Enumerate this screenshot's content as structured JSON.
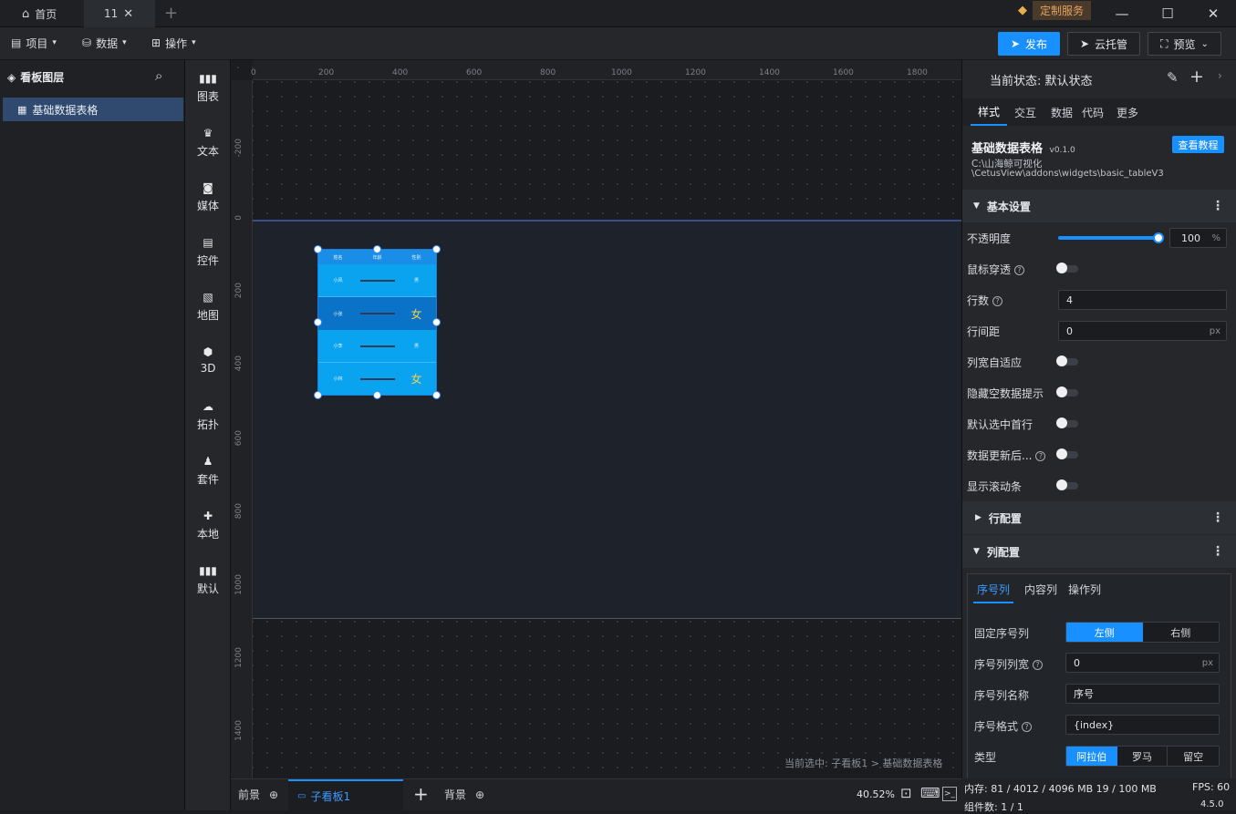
{
  "titlebar": {
    "tabs": [
      {
        "label": "首页",
        "icon": "home-icon"
      },
      {
        "label": "11",
        "icon": "close-icon"
      }
    ],
    "new_tab": "+",
    "custom_service": "定制服务"
  },
  "toolbar": {
    "menus": [
      {
        "label": "项目",
        "icon": "document-icon"
      },
      {
        "label": "数据",
        "icon": "database-icon"
      },
      {
        "label": "操作",
        "icon": "grid-icon"
      }
    ],
    "publish": "发布",
    "cloud": "云托管",
    "preview": "预览"
  },
  "layers": {
    "title": "看板图层",
    "items": [
      "基础数据表格"
    ]
  },
  "components": [
    {
      "label": "图表",
      "icon": "bar-chart-icon"
    },
    {
      "label": "文本",
      "icon": "crown-icon"
    },
    {
      "label": "媒体",
      "icon": "media-icon"
    },
    {
      "label": "控件",
      "icon": "form-icon"
    },
    {
      "label": "地图",
      "icon": "map-icon"
    },
    {
      "label": "3D",
      "icon": "cube-icon"
    },
    {
      "label": "拓扑",
      "icon": "topology-icon"
    },
    {
      "label": "套件",
      "icon": "shirt-icon"
    },
    {
      "label": "本地",
      "icon": "puzzle-icon"
    },
    {
      "label": "默认",
      "icon": "default-chart-icon"
    }
  ],
  "ruler": {
    "top": [
      "0",
      "200",
      "400",
      "600",
      "800",
      "1000",
      "1200",
      "1400",
      "1600",
      "1800"
    ],
    "left": [
      "-200",
      "0",
      "200",
      "400",
      "600",
      "800",
      "1000",
      "1200",
      "1400"
    ]
  },
  "widget": {
    "headers": [
      "姓名",
      "年龄",
      "性别"
    ],
    "rows": [
      {
        "name": "小风",
        "gender": "男"
      },
      {
        "name": "小张",
        "gender": "女"
      },
      {
        "name": "小李",
        "gender": "男"
      },
      {
        "name": "小林",
        "gender": "女"
      }
    ]
  },
  "canvas": {
    "breadcrumb": "当前选中: 子看板1 > 基础数据表格",
    "bottom_tabs": {
      "foreground": "前景",
      "sub_board": "子看板1",
      "add": "+",
      "background": "背景"
    },
    "zoom": "40.52%"
  },
  "right_panel": {
    "state_label": "当前状态:",
    "state_value": "默认状态",
    "tabs": [
      "样式",
      "交互",
      "数据",
      "代码",
      "更多"
    ],
    "widget_name": "基础数据表格",
    "version": "v0.1.0",
    "tutorial_button": "查看教程",
    "path_line1": "C:\\山海鲸可视化",
    "path_line2": "\\CetusView\\addons\\widgets\\basic_tableV3",
    "basic_section": "基本设置",
    "opacity_label": "不透明度",
    "opacity_value": "100",
    "opacity_unit": "%",
    "mouse_through": "鼠标穿透",
    "rows_label": "行数",
    "rows_value": "4",
    "row_gap_label": "行间距",
    "row_gap_value": "0",
    "unit_px": "px",
    "col_auto_label": "列宽自适应",
    "hide_empty_label": "隐藏空数据提示",
    "select_first_label": "默认选中首行",
    "data_update_label": "数据更新后...",
    "show_scrollbar_label": "显示滚动条",
    "row_config": "行配置",
    "col_config": "列配置",
    "col_tabs": [
      "序号列",
      "内容列",
      "操作列"
    ],
    "fixed_index_label": "固定序号列",
    "fixed_left": "左侧",
    "fixed_right": "右侧",
    "index_width_label": "序号列列宽",
    "index_width_value": "0",
    "index_name_label": "序号列名称",
    "index_name_value": "序号",
    "index_format_label": "序号格式",
    "index_format_value": "{index}",
    "type_label": "类型",
    "type_options": [
      "阿拉伯",
      "罗马",
      "留空"
    ]
  },
  "status": {
    "memory_label": "内存:",
    "memory_value": "81 / 4012 / 4096 MB  19 / 100 MB",
    "fps_label": "FPS:",
    "fps_value": "60",
    "component_count": "组件数: 1 / 1",
    "version": "4.5.0"
  },
  "colors": {
    "accent": "#1890ff",
    "widget_blue": "#0aa3f0",
    "panel_bg": "#25272b"
  }
}
